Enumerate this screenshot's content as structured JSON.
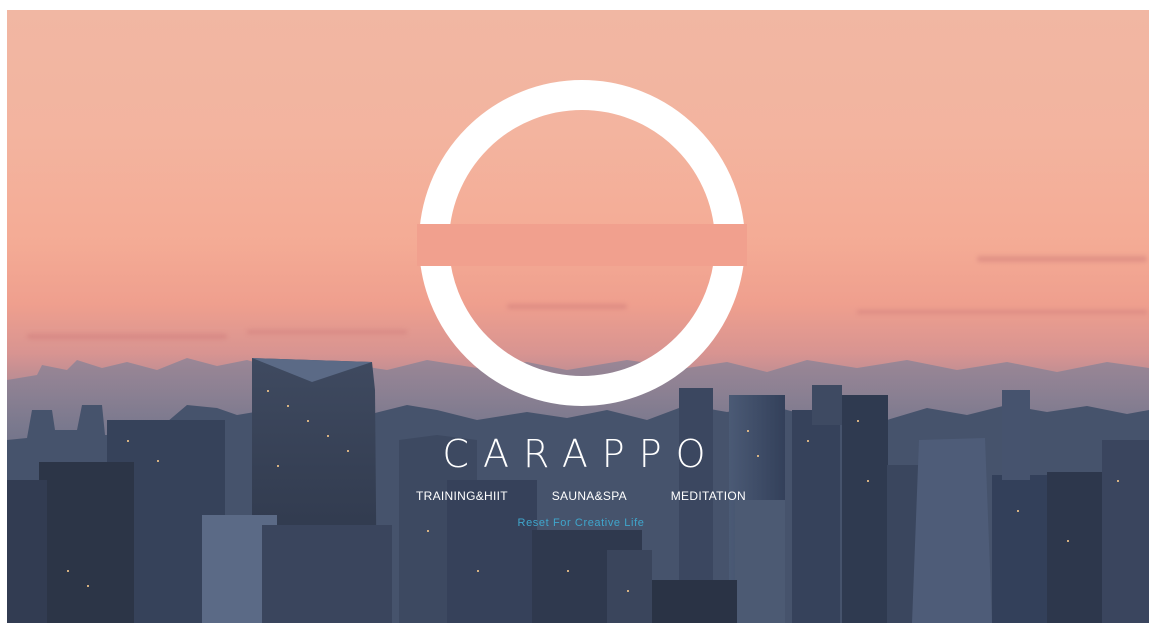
{
  "hero": {
    "brand_name": "CARAPPO",
    "services": [
      "TRAINING&HIIT",
      "SAUNA&SPA",
      "MEDITATION"
    ],
    "tagline": "Reset For Creative Life",
    "logo_icon": "open-ring-logo",
    "colors": {
      "sky_top": "#f1b7a3",
      "sky_horizon": "#ef9f8e",
      "city": "#3a465d",
      "brand_text": "#ffffff",
      "tagline_text": "#3fa6cc"
    }
  }
}
